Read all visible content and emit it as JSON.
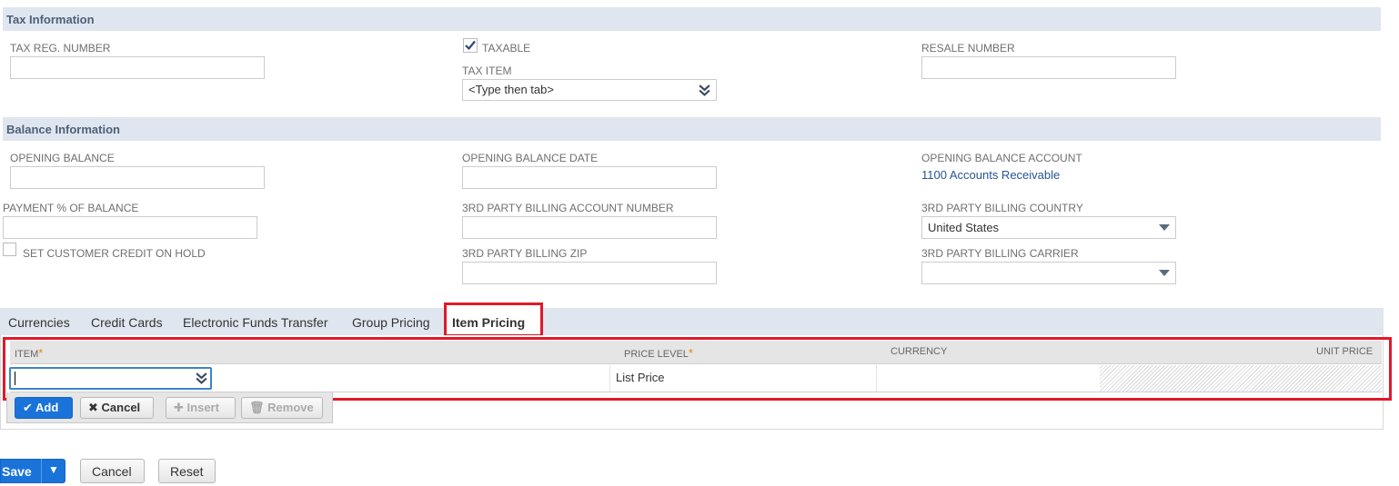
{
  "tax_section": {
    "title": "Tax Information",
    "tax_reg_label": "TAX REG. NUMBER",
    "tax_reg_value": "",
    "taxable_label": "TAXABLE",
    "taxable_checked": true,
    "tax_item_label": "TAX ITEM",
    "tax_item_value": "<Type then tab>",
    "resale_label": "RESALE NUMBER",
    "resale_value": ""
  },
  "balance_section": {
    "title": "Balance Information",
    "opening_balance_label": "OPENING BALANCE",
    "opening_balance_value": "",
    "opening_balance_date_label": "OPENING BALANCE DATE",
    "opening_balance_date_value": "",
    "opening_balance_account_label": "OPENING BALANCE ACCOUNT",
    "opening_balance_account_value": "1100 Accounts Receivable",
    "payment_pct_label": "PAYMENT % OF BALANCE",
    "payment_pct_value": "",
    "third_party_account_label": "3RD PARTY BILLING ACCOUNT NUMBER",
    "third_party_account_value": "",
    "third_party_country_label": "3RD PARTY BILLING COUNTRY",
    "third_party_country_value": "United States",
    "credit_hold_label": "SET CUSTOMER CREDIT ON HOLD",
    "credit_hold_checked": false,
    "third_party_zip_label": "3RD PARTY BILLING ZIP",
    "third_party_zip_value": "",
    "third_party_carrier_label": "3RD PARTY BILLING CARRIER",
    "third_party_carrier_value": ""
  },
  "tabs": [
    {
      "label": "Currencies",
      "active": false
    },
    {
      "label": "Credit Cards",
      "active": false
    },
    {
      "label": "Electronic Funds Transfer",
      "active": false
    },
    {
      "label": "Group Pricing",
      "active": false
    },
    {
      "label": "Item Pricing",
      "active": true
    }
  ],
  "item_pricing": {
    "columns": {
      "item": "ITEM",
      "price_level": "PRICE LEVEL",
      "currency": "CURRENCY",
      "unit_price": "UNIT PRICE"
    },
    "required_marker": "*",
    "row": {
      "item": "",
      "price_level": "List Price",
      "currency": "",
      "unit_price": ""
    },
    "buttons": {
      "add": "Add",
      "cancel": "Cancel",
      "insert": "Insert",
      "remove": "Remove"
    }
  },
  "footer": {
    "save": "Save",
    "cancel": "Cancel",
    "reset": "Reset"
  },
  "colors": {
    "section_bar": "#e0e6ef",
    "highlight_red": "#e0192a",
    "primary_blue": "#1a73d9",
    "link_blue": "#255599"
  }
}
